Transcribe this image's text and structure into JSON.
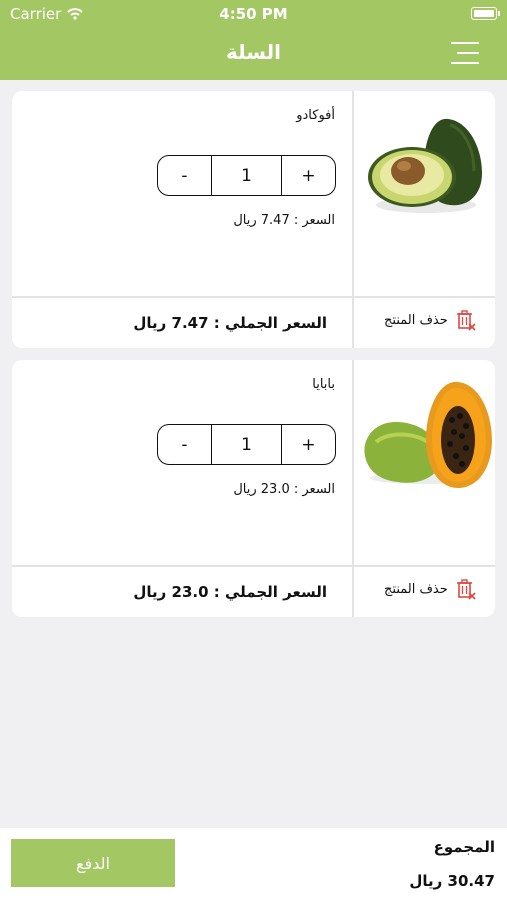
{
  "status_bar": {
    "carrier": "Carrier",
    "time": "4:50 PM"
  },
  "header": {
    "title": "السلة"
  },
  "items": [
    {
      "name": "أفوكادو",
      "quantity": "1",
      "minus": "-",
      "plus": "+",
      "unit_price": "السعر : 7.47 ريال",
      "total": "السعر الجملي : 7.47 ريال",
      "delete_label": "حذف المنتج"
    },
    {
      "name": "بابايا",
      "quantity": "1",
      "minus": "-",
      "plus": "+",
      "unit_price": "السعر : 23.0 ريال",
      "total": "السعر الجملي : 23.0 ريال",
      "delete_label": "حذف المنتج"
    }
  ],
  "footer": {
    "pay_label": "الدفع",
    "sum_label": "المجموع",
    "sum_value": "30.47 ريال"
  },
  "colors": {
    "brand": "#a3c763",
    "delete_icon": "#e0483f"
  }
}
